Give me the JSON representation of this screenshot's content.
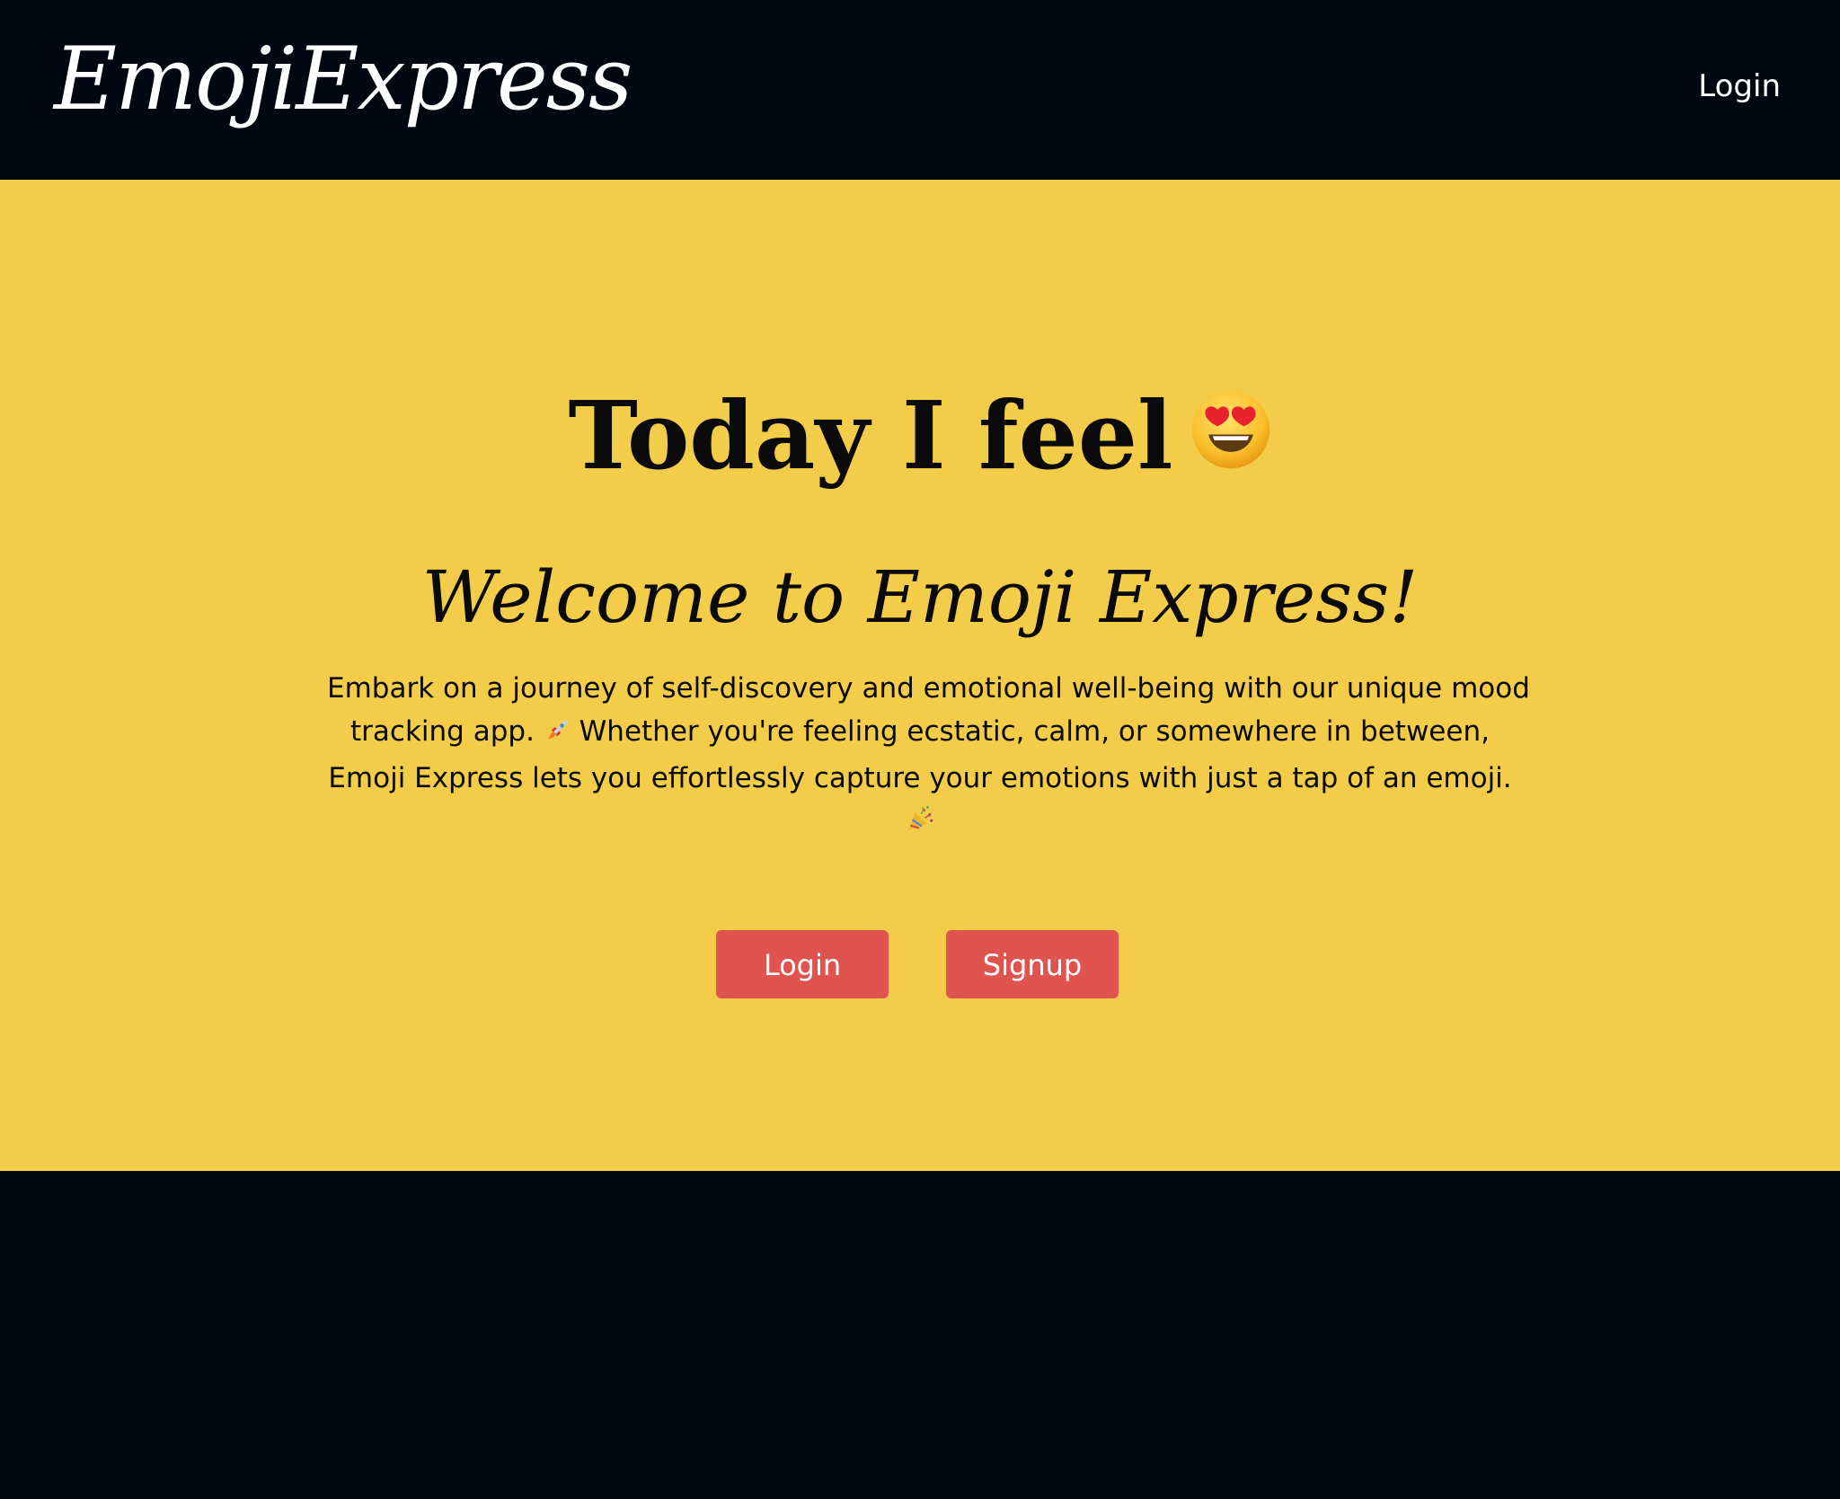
{
  "header": {
    "brand": "EmojiExpress",
    "nav_login": "Login"
  },
  "hero": {
    "title": "Today I feel",
    "title_emoji": "heart-eyes-face-icon",
    "subtitle": "Welcome to Emoji Express!",
    "description": {
      "line1": "Embark on a journey of self-discovery and emotional well-being with our unique mood",
      "line2_before": "tracking app.",
      "line2_emoji": "rocket-icon",
      "line2_after": "Whether you're feeling ecstatic, calm, or somewhere in between,",
      "line3": "Emoji Express lets you effortlessly capture your emotions with just a tap of an emoji.",
      "line4_emoji": "party-popper-icon"
    },
    "buttons": {
      "login": "Login",
      "signup": "Signup"
    }
  },
  "colors": {
    "nav_background": "#030712",
    "hero_background": "#f3cd4a",
    "button_background": "#e0544f",
    "text_light": "#ffffff",
    "text_dark": "#0a0a0a"
  }
}
